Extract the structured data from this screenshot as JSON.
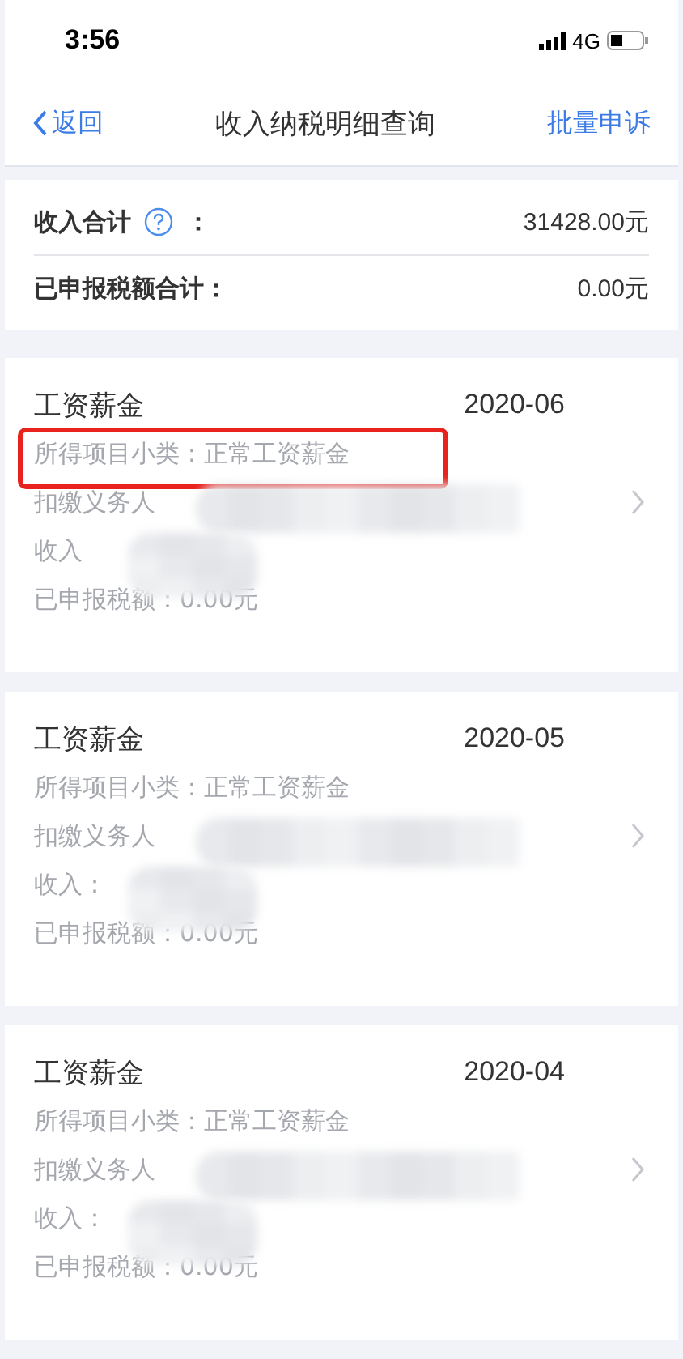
{
  "status_bar": {
    "time": "3:56",
    "network": "4G"
  },
  "nav": {
    "back": "返回",
    "title": "收入纳税明细查询",
    "action": "批量申诉"
  },
  "summary": [
    {
      "label": "收入合计",
      "help": true,
      "colon": "：",
      "value": "31428.00元"
    },
    {
      "label": "已申报税额合计：",
      "help": false,
      "value": "0.00元"
    }
  ],
  "records": [
    {
      "title": "工资薪金",
      "period": "2020-06",
      "subtype": "所得项目小类：正常工资薪金",
      "highlighted": true,
      "payer_label": "扣缴义务人",
      "income_label": "收入",
      "tax": "已申报税额：0.00元"
    },
    {
      "title": "工资薪金",
      "period": "2020-05",
      "subtype": "所得项目小类：正常工资薪金",
      "highlighted": false,
      "payer_label": "扣缴义务人",
      "income_label": "收入：",
      "tax": "已申报税额：0.00元"
    },
    {
      "title": "工资薪金",
      "period": "2020-04",
      "subtype": "所得项目小类：正常工资薪金",
      "highlighted": false,
      "payer_label": "扣缴义务人",
      "income_label": "收入：",
      "tax": "已申报税额：0.00元"
    }
  ]
}
